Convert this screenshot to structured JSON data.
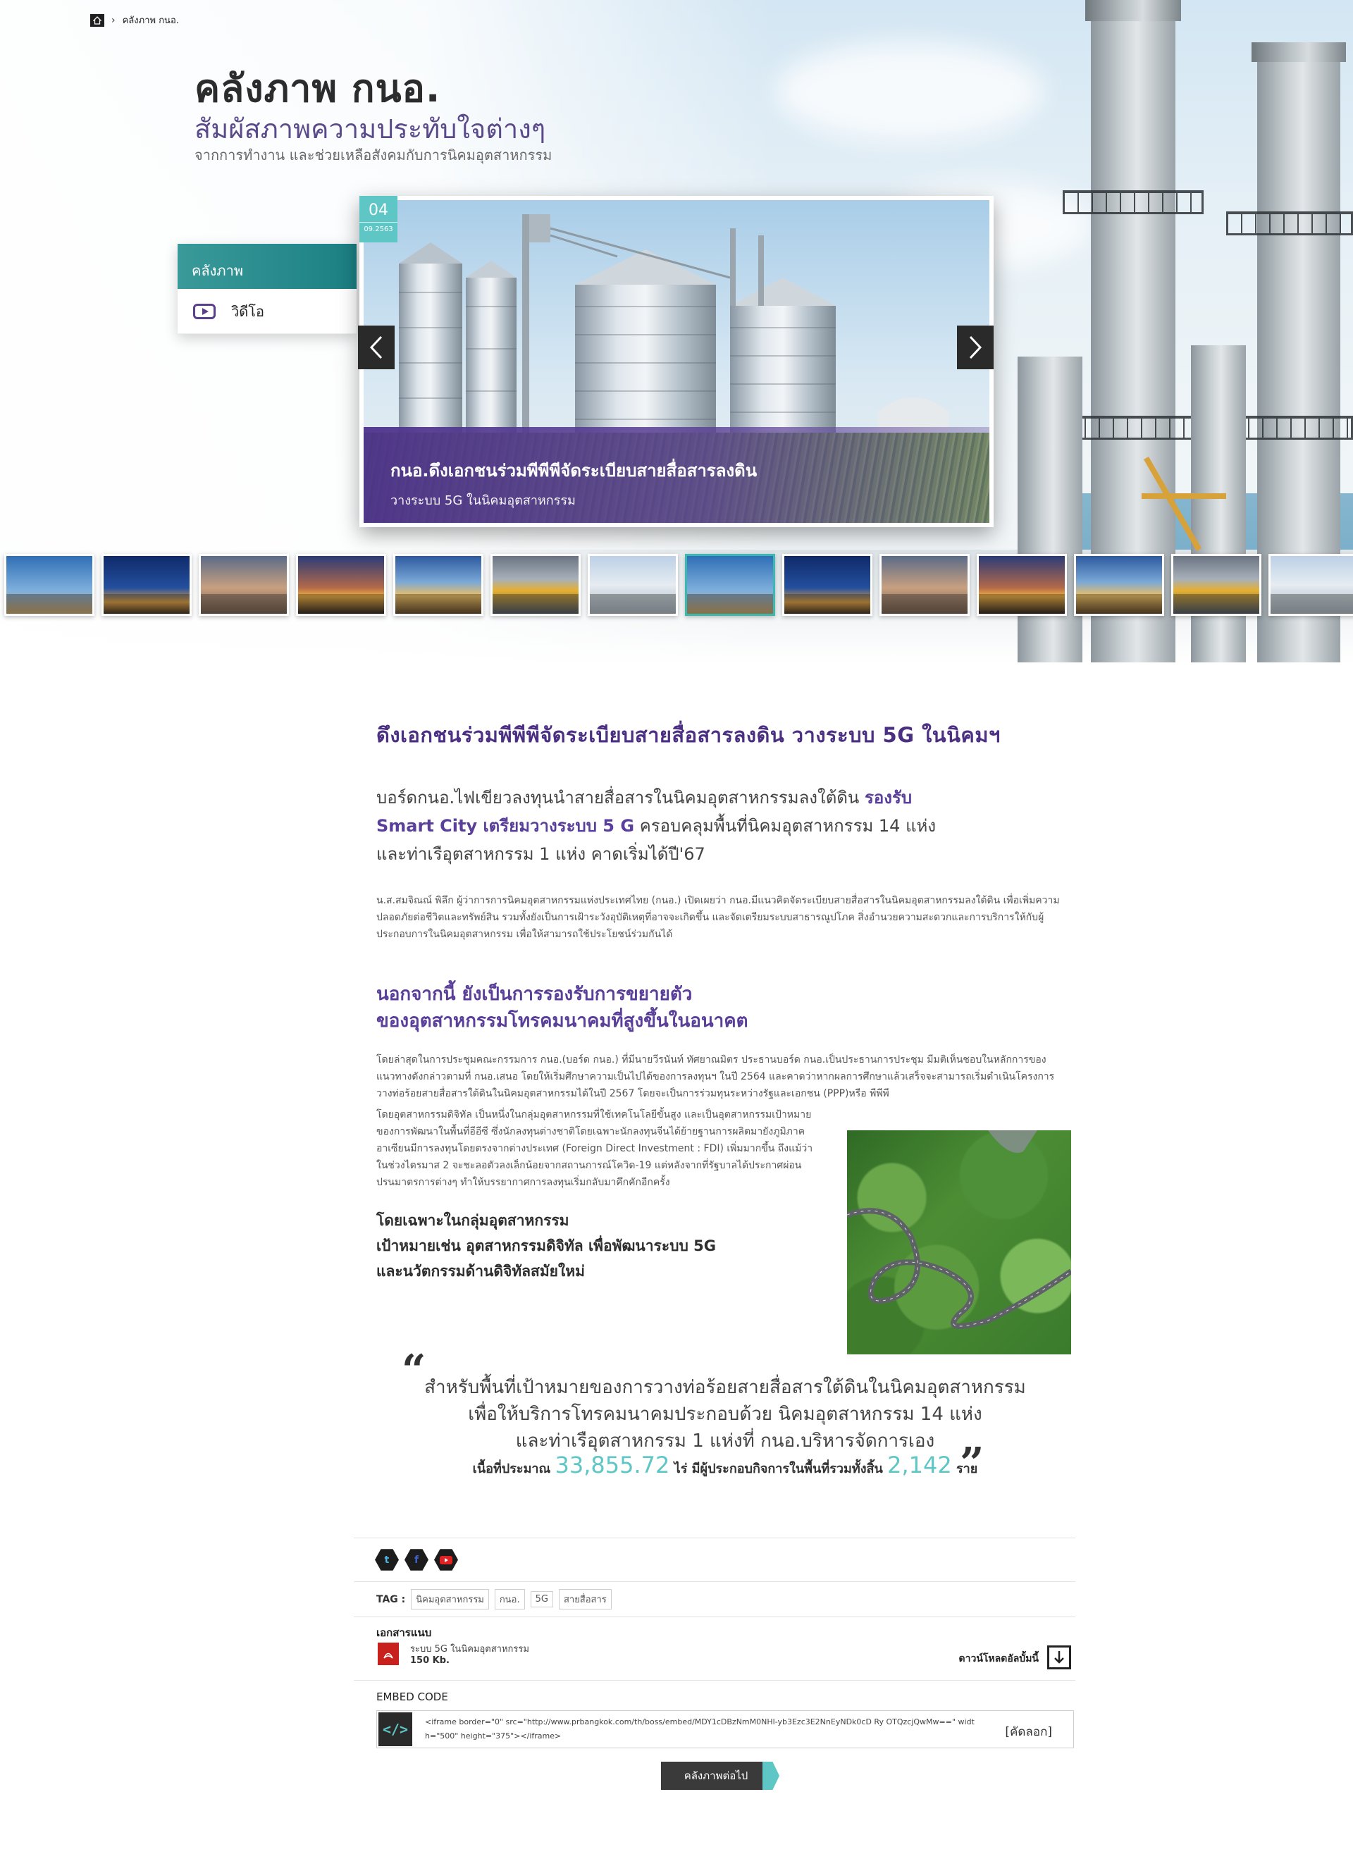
{
  "breadcrumb": {
    "current": "คลังภาพ กนอ."
  },
  "header": {
    "title": "คลังภาพ กนอ.",
    "subtitle": "สัมผัสภาพความประทับใจต่างๆ",
    "description": "จากการทำงาน และช่วยเหลือสังคมกับการนิคมอุตสาหกรรม"
  },
  "side_menu": {
    "active_label": "คลังภาพ",
    "video_label": "วิดีโอ"
  },
  "slider": {
    "day": "04",
    "month_year": "09.2563",
    "caption_title": "กนอ.ดึงเอกชนร่วมพีพีพีจัดระเบียบสายสื่อสารลงดิน",
    "caption_subtitle": "วางระบบ 5G ในนิคมอุตสาหกรรม",
    "prev_icon": "chevron-left-icon",
    "next_icon": "chevron-right-icon"
  },
  "thumbnails": [
    {
      "style": "t-blue"
    },
    {
      "style": "t-night"
    },
    {
      "style": "t-dusk"
    },
    {
      "style": "t-sunset"
    },
    {
      "style": "t-gold"
    },
    {
      "style": "t-worker"
    },
    {
      "style": "t-pale"
    },
    {
      "style": "t-blue",
      "selected": true
    },
    {
      "style": "t-night"
    },
    {
      "style": "t-dusk"
    },
    {
      "style": "t-sunset"
    },
    {
      "style": "t-gold"
    },
    {
      "style": "t-worker"
    },
    {
      "style": "t-pale"
    }
  ],
  "article": {
    "title": "ดึงเอกชนร่วมพีพีพีจัดระเบียบสายสื่อสารลงดิน วางระบบ 5G ในนิคมฯ",
    "lead_line1_a": "บอร์ดกนอ.ไฟเขียวลงทุนนำสายสื่อสารในนิคมอุตสาหกรรมลงใต้ดิน ",
    "lead_line1_b": "รองรับ",
    "lead_line2_a": "Smart City เตรียมวางระบบ 5 G",
    "lead_line2_b": " ครอบคลุมพื้นที่นิคมอุตสาหกรรม 14 แห่ง",
    "lead_line3": "และท่าเรือุตสาหกรรม 1 แห่ง คาดเริ่มได้ปี'67",
    "para1": "น.ส.สมจิณณ์ พิลึก ผู้ว่าการการนิคมอุตสาหกรรมแห่งประเทศไทย (กนอ.) เปิดเผยว่า กนอ.มีแนวคิดจัดระเบียบสายสื่อสารในนิคมอุตสาหกรรมลงใต้ดิน เพื่อเพิ่มความปลอดภัยต่อชีวิตและทรัพย์สิน รวมทั้งยังเป็นการเฝ้าระวังอุบัติเหตุที่อาจจะเกิดขึ้น และจัดเตรียมระบบสาธารณูปโภค สิ่งอำนวยความสะดวกและการบริการให้กับผู้ประกอบการในนิคมอุตสาหกรรม เพื่อให้สามารถใช้ประโยชน์ร่วมกันได้",
    "section_head_1": "นอกจากนี้ ยังเป็นการรองรับการขยายตัว",
    "section_head_2": "ของอุตสาหกรรมโทรคมนาคมที่สูงขึ้นในอนาคต",
    "para2": "โดยล่าสุดในการประชุมคณะกรรมการ กนอ.(บอร์ด กนอ.) ที่มีนายวีรนันท์ ทัศยาณมิตร ประธานบอร์ด กนอ.เป็นประธานการประชุม มีมติเห็นชอบในหลักการของแนวทางดังกล่าวตามที่ กนอ.เสนอ โดยให้เริ่มศึกษาความเป็นไปได้ของการลงทุนฯ ในปี 2564 และคาดว่าหากผลการศึกษาแล้วเสร็จจะสามารถเริ่มดำเนินโครงการวางท่อร้อยสายสื่อสารใต้ดินในนิคมอุตสาหกรรมได้ในปี 2567 โดยจะเป็นการร่วมทุนระหว่างรัฐและเอกชน (PPP)หรือ พีพีพี",
    "para3": "โดยอุตสาหกรรมดิจิทัล เป็นหนึ่งในกลุ่มอุตสาหกรรมที่ใช้เทคโนโลยีขั้นสูง และเป็นอุตสาหกรรมเป้าหมายของการพัฒนาในพื้นที่อีอีซี ซึ่งนักลงทุนต่างชาติโดยเฉพาะนักลงทุนจีนได้ย้ายฐานการผลิตมายังภูมิภาคอาเซียนมีการลงทุนโดยตรงจากต่างประเทศ (Foreign Direct Investment : FDI) เพิ่มมากขึ้น ถึงแม้ว่าในช่วงไตรมาส 2 จะชะลอตัวลงเล็กน้อยจากสถานการณ์โควิด-19 แต่หลังจากที่รัฐบาลได้ประกาศผ่อนปรนมาตรการต่างๆ ทำให้บรรยากาศการลงทุนเริ่มกลับมาคึกคักอีกครั้ง",
    "bold_line1": "โดยเฉพาะในกลุ่มอุตสาหกรรม",
    "bold_line2": "เป้าหมายเช่น อุตสาหกรรมดิจิทัล เพื่อพัฒนาระบบ 5G",
    "bold_line3": "และนวัตกรรมด้านดิจิทัลสมัยใหม่"
  },
  "quote": {
    "line1": "สำหรับพื้นที่เป้าหมายของการวางท่อร้อยสายสื่อสารใต้ดินในนิคมอุตสาหกรรม",
    "line2": "เพื่อให้บริการโทรคมนาคมประกอบด้วย นิคมอุตสาหกรรม 14 แห่ง",
    "line3": "และท่าเรือุตสาหกรรม 1 แห่งที่ กนอ.บริหารจัดการเอง",
    "stats_prefix": "เนื้อที่ประมาณ",
    "area_value": "33,855.72",
    "stats_middle": "ไร่ มีผู้ประกอบกิจการในพื้นที่รวมทั้งสิ้น",
    "operators_value": "2,142",
    "stats_suffix": "ราย"
  },
  "share": {
    "twitter_icon": "twitter-icon",
    "facebook_icon": "facebook-icon",
    "youtube_icon": "youtube-icon"
  },
  "tags": {
    "label": "TAG :",
    "items": [
      "นิคมอุตสาหกรรม",
      "กนอ.",
      "5G",
      "สายสื่อสาร"
    ]
  },
  "attachment": {
    "label": "เอกสารแนบ",
    "file_name": "ระบบ 5G ในนิคมอุตสาหกรรม",
    "file_size": "150 Kb.",
    "download_label": "ดาวน์โหลดอัลบั้มนี้"
  },
  "embed": {
    "label": "EMBED CODE",
    "code": "<iframe border=\"0\" src=\"http://www.prbangkok.com/th/boss/embed/MDY1cDBzNmM0NHl-yb3Ezc3E2NnEyNDk0cD Ry OTQzcjQwMw==\" width=\"500\" height=\"375\"></iframe>",
    "copy_label": "[คัดลอก]"
  },
  "more_button": {
    "label": "คลังภาพต่อไป"
  },
  "colors": {
    "brand_purple": "#5a3f9a",
    "teal": "#5fc6c6",
    "dark": "#2a2a2a"
  }
}
